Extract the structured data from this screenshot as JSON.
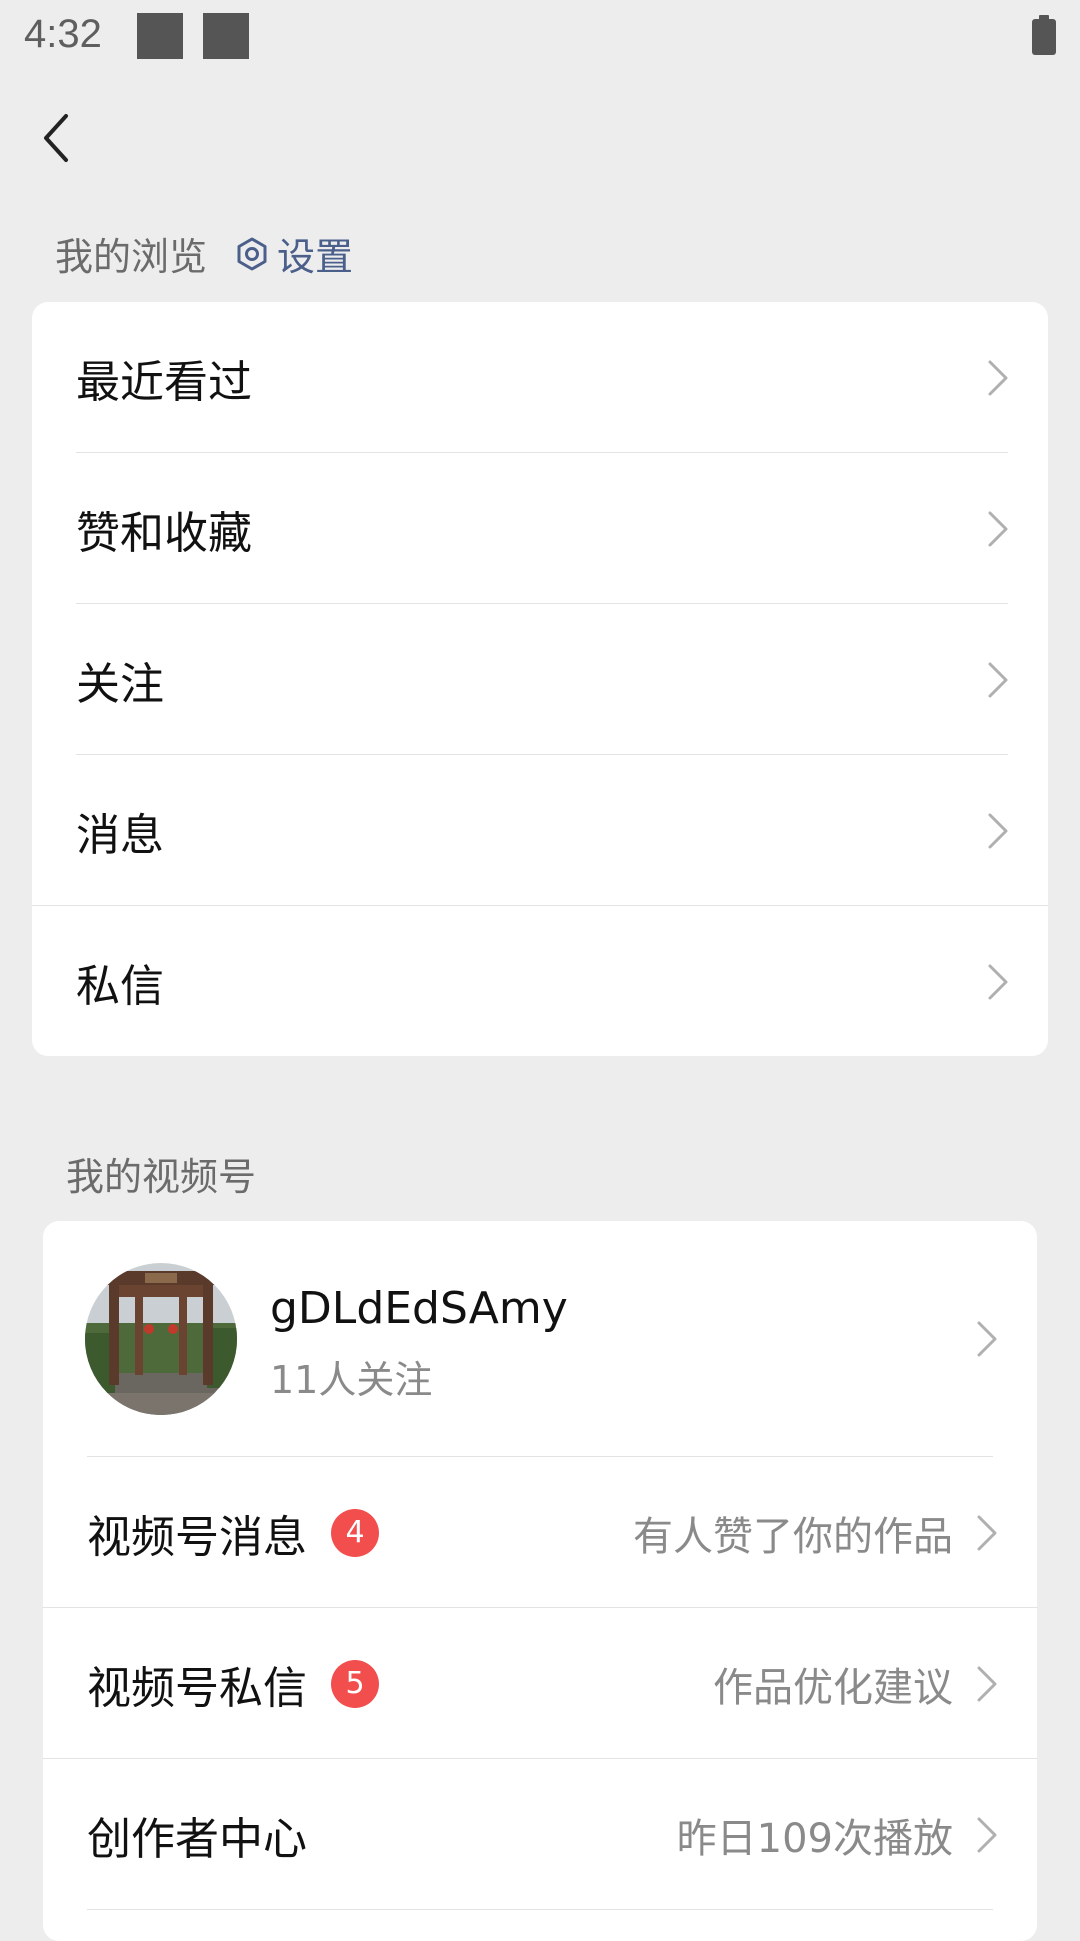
{
  "status_bar": {
    "time": "4:32"
  },
  "header": {
    "back_icon": "chevron-left-icon"
  },
  "browse_section": {
    "title": "我的浏览",
    "settings_label": "设置",
    "settings_icon": "hexagon-gear-icon",
    "items": [
      {
        "label": "最近看过"
      },
      {
        "label": "赞和收藏"
      },
      {
        "label": "关注"
      },
      {
        "label": "消息"
      },
      {
        "label": "私信"
      }
    ]
  },
  "channels_section": {
    "title": "我的视频号",
    "profile": {
      "name": "gDLdEdSAmy",
      "followers": "11人关注"
    },
    "items": [
      {
        "label": "视频号消息",
        "badge": "4",
        "hint": "有人赞了你的作品"
      },
      {
        "label": "视频号私信",
        "badge": "5",
        "hint": "作品优化建议"
      },
      {
        "label": "创作者中心",
        "badge": "",
        "hint": "昨日109次播放"
      }
    ]
  },
  "colors": {
    "background": "#ededed",
    "card": "#ffffff",
    "link": "#4a5f8a",
    "badge": "#f24e4e",
    "secondary_text": "#8a8a8a"
  }
}
